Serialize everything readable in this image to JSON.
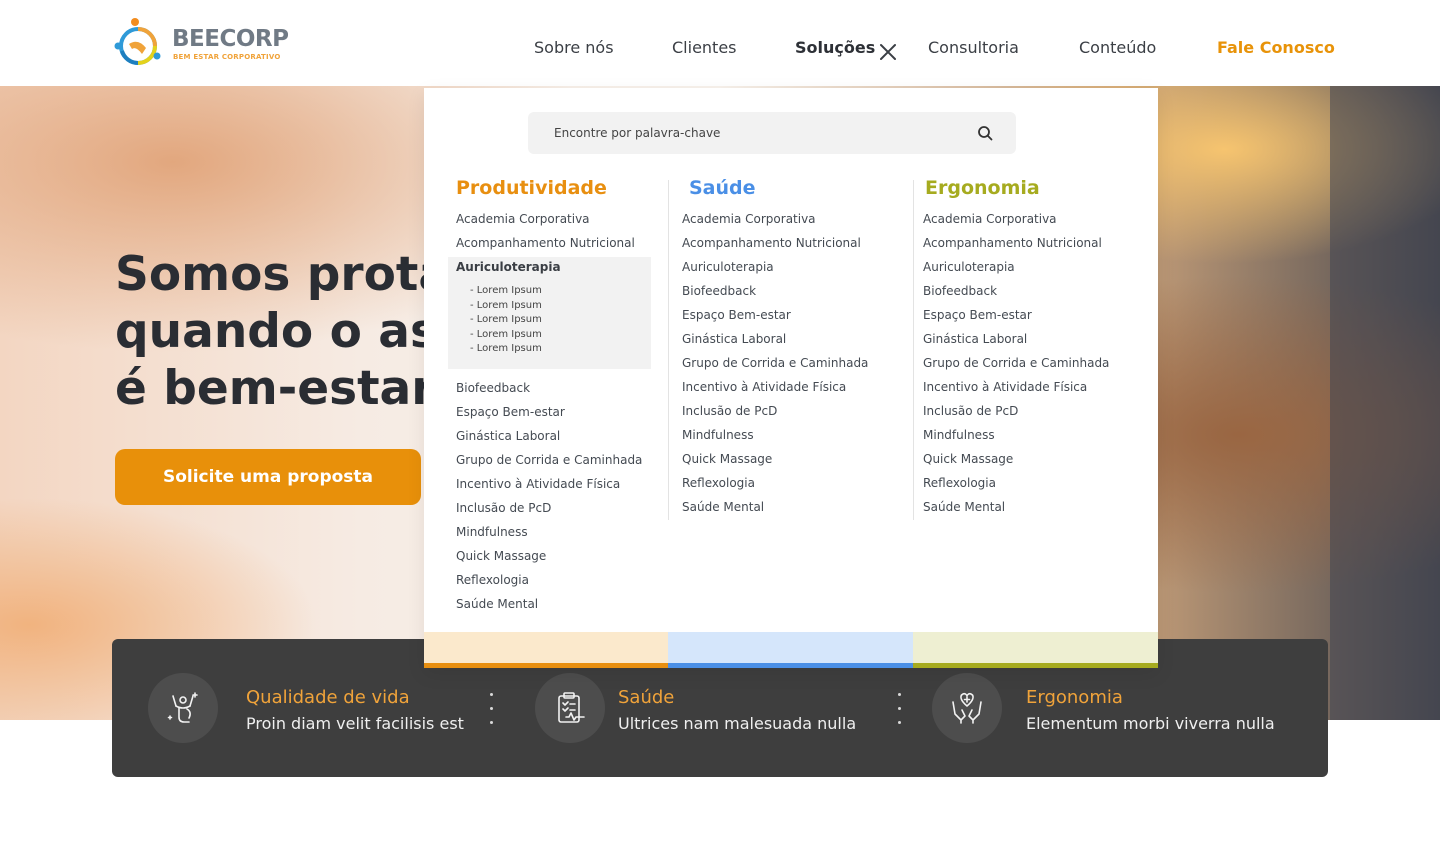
{
  "brand": {
    "name": "BEECORP",
    "tagline": "BEM ESTAR CORPORATIVO"
  },
  "nav": {
    "items": [
      "Sobre nós",
      "Clientes",
      "Soluções",
      "Consultoria",
      "Conteúdo"
    ],
    "active": "Soluções",
    "cta": "Fale Conosco"
  },
  "hero": {
    "title_lines": [
      "Somos prota",
      "quando o as",
      "é bem-estar."
    ],
    "button": "Solicite uma proposta"
  },
  "features": [
    {
      "title": "Qualidade de vida",
      "subtitle": "Proin diam velit facilisis est",
      "icon": "wellness-person-icon"
    },
    {
      "title": "Saúde",
      "subtitle": "Ultrices nam malesuada nulla",
      "icon": "medical-clipboard-icon"
    },
    {
      "title": "Ergonomia",
      "subtitle": "Elementum morbi viverra nulla",
      "icon": "care-hands-icon"
    }
  ],
  "menu": {
    "search_placeholder": "Encontre por palavra-chave",
    "columns": [
      {
        "title": "Produtividade",
        "color": "#e88f10",
        "items": [
          "Academia Corporativa",
          "Acompanhamento Nutricional",
          "Auriculoterapia",
          "Biofeedback",
          "Espaço Bem-estar",
          "Ginástica Laboral",
          "Grupo de Corrida e Caminhada",
          "Incentivo à Atividade Física",
          "Inclusão de PcD",
          "Mindfulness",
          "Quick Massage",
          "Reflexologia",
          "Saúde Mental"
        ],
        "expanded_item": "Auriculoterapia",
        "subitems": [
          "- Lorem Ipsum",
          "- Lorem Ipsum",
          "- Lorem Ipsum",
          "- Lorem Ipsum",
          "- Lorem Ipsum"
        ]
      },
      {
        "title": "Saúde",
        "color": "#4a8fe6",
        "items": [
          "Academia Corporativa",
          "Acompanhamento Nutricional",
          "Auriculoterapia",
          "Biofeedback",
          "Espaço Bem-estar",
          "Ginástica Laboral",
          "Grupo de Corrida e Caminhada",
          "Incentivo à Atividade Física",
          "Inclusão de PcD",
          "Mindfulness",
          "Quick Massage",
          "Reflexologia",
          "Saúde Mental"
        ]
      },
      {
        "title": "Ergonomia",
        "color": "#a6ab1f",
        "items": [
          "Academia Corporativa",
          "Acompanhamento Nutricional",
          "Auriculoterapia",
          "Biofeedback",
          "Espaço Bem-estar",
          "Ginástica Laboral",
          "Grupo de Corrida e Caminhada",
          "Incentivo à Atividade Física",
          "Inclusão de PcD",
          "Mindfulness",
          "Quick Massage",
          "Reflexologia",
          "Saúde Mental"
        ]
      }
    ],
    "strips": [
      {
        "bg": "#fbe9cc",
        "bar": "#e88f10"
      },
      {
        "bg": "#d5e6fb",
        "bar": "#4a8fe6"
      },
      {
        "bg": "#eeefd2",
        "bar": "#a6ab1f"
      }
    ]
  },
  "colors": {
    "accent": "#e8900a",
    "dark_bar": "#3e3e3e",
    "text_dark": "#2a2d33"
  }
}
